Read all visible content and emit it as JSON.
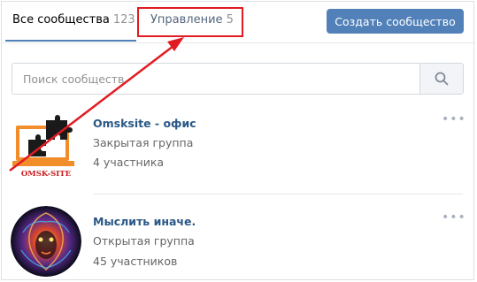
{
  "tabs": [
    {
      "label": "Все сообщества",
      "count": "123"
    },
    {
      "label": "Управление",
      "count": "5"
    }
  ],
  "create_button": "Создать сообщество",
  "search": {
    "placeholder": "Поиск сообществ"
  },
  "groups": [
    {
      "name": "Omsksite - офис",
      "type": "Закрытая группа",
      "members": "4 участника",
      "logo_text": "OMSK-SITE"
    },
    {
      "name": "Мыслить иначе.",
      "type": "Открытая группа",
      "members": "45 участников"
    }
  ],
  "colors": {
    "accent": "#5181b8",
    "link": "#2a5885",
    "annotation": "#e11b22"
  }
}
